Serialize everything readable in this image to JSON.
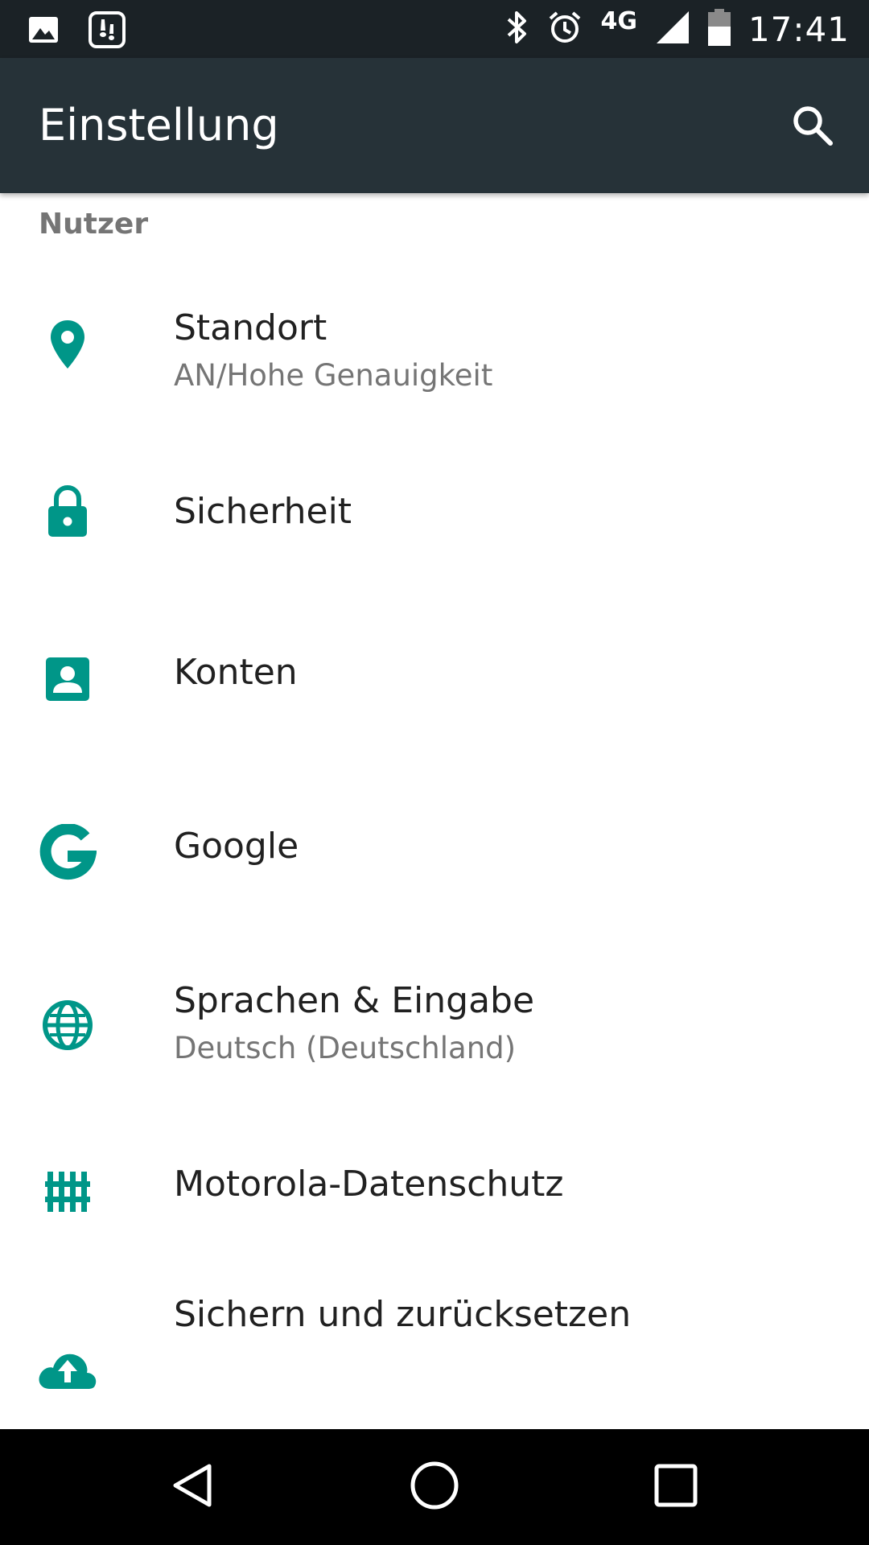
{
  "status_bar": {
    "time": "17:41",
    "network": "4G",
    "icons": [
      "image-notification-icon",
      "app-notification-icon",
      "bluetooth-icon",
      "alarm-icon",
      "signal-icon",
      "battery-icon"
    ]
  },
  "app_bar": {
    "title": "Einstellung",
    "search_icon": "search-icon"
  },
  "section": {
    "header": "Nutzer"
  },
  "items": [
    {
      "title": "Standort",
      "summary": "AN/Hohe Genauigkeit",
      "icon": "location-icon"
    },
    {
      "title": "Sicherheit",
      "summary": "",
      "icon": "lock-icon"
    },
    {
      "title": "Konten",
      "summary": "",
      "icon": "account-icon"
    },
    {
      "title": "Google",
      "summary": "",
      "icon": "google-icon"
    },
    {
      "title": "Sprachen & Eingabe",
      "summary": "Deutsch (Deutschland)",
      "icon": "globe-icon"
    },
    {
      "title": "Motorola-Datenschutz",
      "summary": "",
      "icon": "privacy-fence-icon"
    },
    {
      "title": "Sichern und zurücksetzen",
      "summary": "",
      "icon": "backup-icon"
    }
  ],
  "nav_bar": {
    "icons": [
      "back-icon",
      "home-icon",
      "recents-icon"
    ]
  },
  "colors": {
    "status_bar": "#1b2226",
    "app_bar": "#263238",
    "accent": "#009688",
    "title_text": "#212121",
    "secondary_text": "#757575"
  }
}
